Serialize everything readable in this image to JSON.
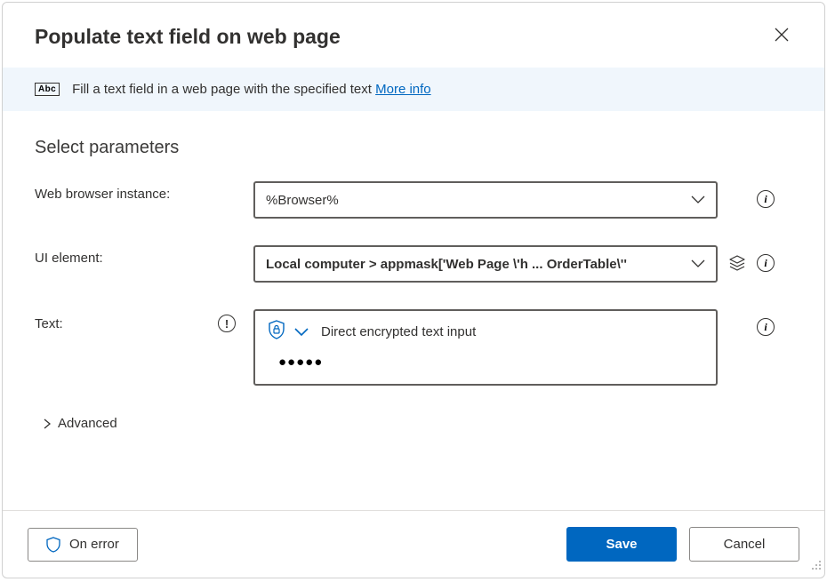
{
  "header": {
    "title": "Populate text field on web page"
  },
  "info": {
    "icon_label": "Abc",
    "description": "Fill a text field in a web page with the specified text ",
    "link_text": "More info"
  },
  "section": {
    "title": "Select parameters"
  },
  "params": {
    "browser": {
      "label": "Web browser instance:",
      "value": "%Browser%"
    },
    "ui_element": {
      "label": "UI element:",
      "value": "Local computer > appmask['Web Page \\'h ... OrderTable\\''"
    },
    "text": {
      "label": "Text:",
      "type_label": "Direct encrypted text input",
      "value": "●●●●●"
    }
  },
  "advanced": {
    "label": "Advanced"
  },
  "footer": {
    "on_error": "On error",
    "save": "Save",
    "cancel": "Cancel"
  }
}
